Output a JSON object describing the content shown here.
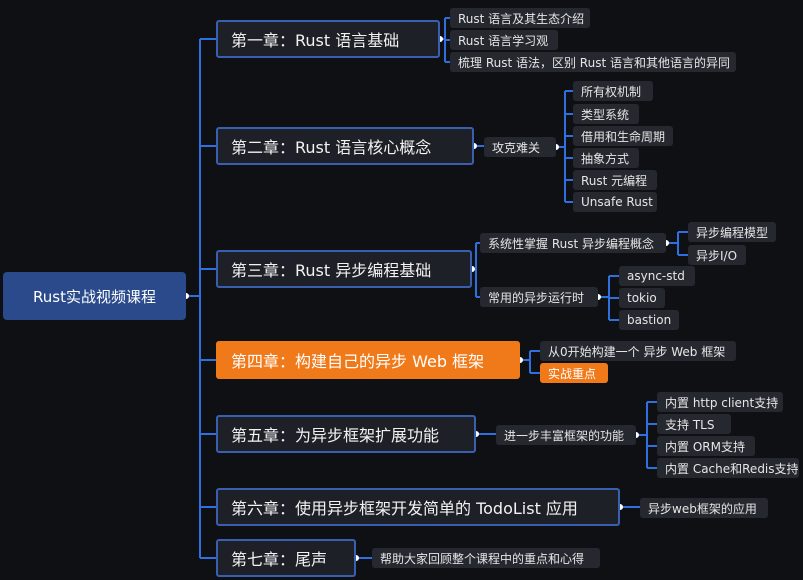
{
  "root": "Rust实战视频课程",
  "chapters": [
    {
      "label": "第一章：Rust 语言基础"
    },
    {
      "label": "第二章：Rust 语言核心概念"
    },
    {
      "label": "第三章：Rust 异步编程基础"
    },
    {
      "label": "第四章：构建自己的异步 Web 框架"
    },
    {
      "label": "第五章：为异步框架扩展功能"
    },
    {
      "label": "第六章：使用异步框架开发简单的 TodoList 应用"
    },
    {
      "label": "第七章：尾声"
    }
  ],
  "ch1": {
    "items": [
      "Rust 语言及其生态介绍",
      "Rust 语言学习观",
      "梳理 Rust 语法，区别 Rust 语言和其他语言的异同"
    ]
  },
  "ch2": {
    "mid": "攻克难关",
    "items": [
      "所有权机制",
      "类型系统",
      "借用和生命周期",
      "抽象方式",
      "Rust 元编程",
      "Unsafe Rust"
    ]
  },
  "ch3": {
    "mid1": "系统性掌握 Rust 异步编程概念",
    "mid1_items": [
      "异步编程模型",
      "异步I/O"
    ],
    "mid2": "常用的异步运行时",
    "mid2_items": [
      "async-std",
      "tokio",
      "bastion"
    ]
  },
  "ch4": {
    "items": [
      "从0开始构建一个 异步 Web 框架",
      "实战重点"
    ]
  },
  "ch5": {
    "mid": "进一步丰富框架的功能",
    "items": [
      "内置 http client支持",
      "支持 TLS",
      "内置 ORM支持",
      "内置 Cache和Redis支持"
    ]
  },
  "ch6": {
    "item": "异步web框架的应用"
  },
  "ch7": {
    "item": "帮助大家回顾整个课程中的重点和心得"
  },
  "colors": {
    "connector": "#2f6fe0",
    "highlight": "#f07a1a",
    "root_bg": "#2a4a8c"
  }
}
